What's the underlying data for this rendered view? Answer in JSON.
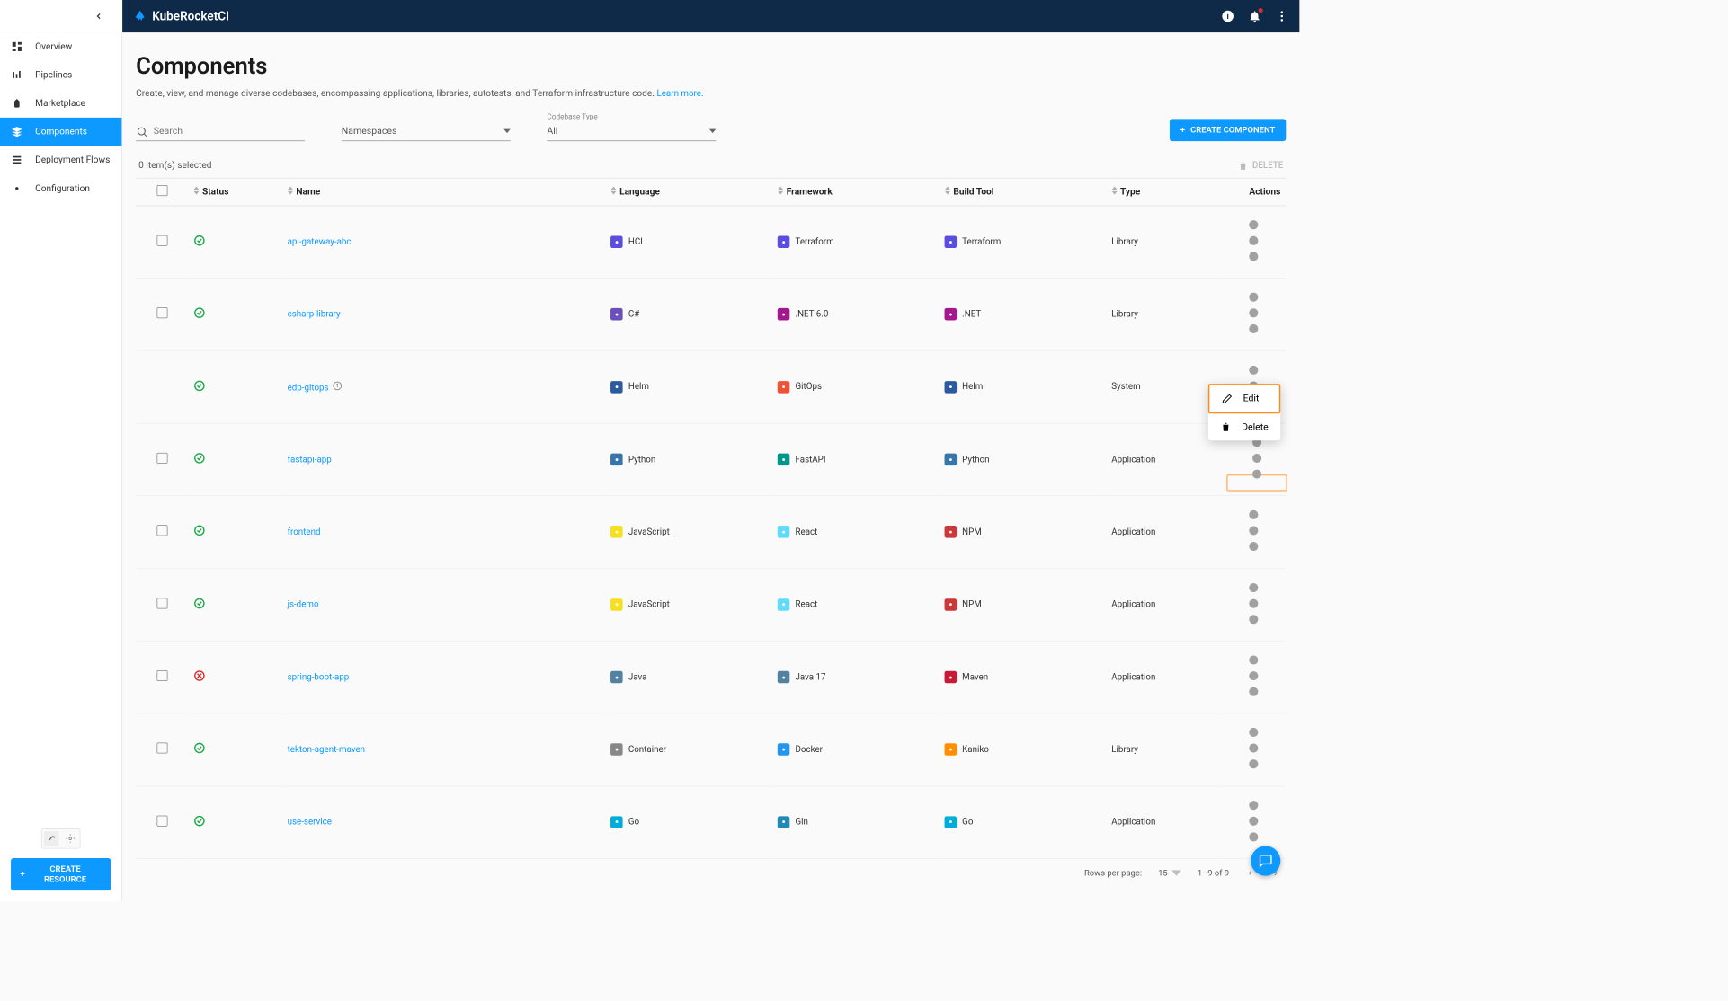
{
  "app": {
    "name": "KubeRocketCI"
  },
  "sidebar": {
    "items": [
      {
        "label": "Overview"
      },
      {
        "label": "Pipelines"
      },
      {
        "label": "Marketplace"
      },
      {
        "label": "Components"
      },
      {
        "label": "Deployment Flows"
      },
      {
        "label": "Configuration"
      }
    ],
    "create_resource": "CREATE RESOURCE"
  },
  "page": {
    "title": "Components",
    "subtitle": "Create, view, and manage diverse codebases, encompassing applications, libraries, autotests, and Terraform infrastructure code.",
    "learn_more": "Learn more."
  },
  "filters": {
    "search_placeholder": "Search",
    "namespaces_label": "Namespaces",
    "codebase_type_label": "Codebase Type",
    "codebase_type_value": "All",
    "create_component": "CREATE COMPONENT"
  },
  "selection": {
    "text": "0 item(s) selected",
    "delete": "DELETE"
  },
  "columns": {
    "status": "Status",
    "name": "Name",
    "language": "Language",
    "framework": "Framework",
    "buildtool": "Build Tool",
    "type": "Type",
    "actions": "Actions"
  },
  "rows": [
    {
      "name": "api-gateway-abc",
      "lang": "HCL",
      "framework": "Terraform",
      "buildtool": "Terraform",
      "type": "Library",
      "status": "ok",
      "selectable": true,
      "lang_bg": "#5b4de0",
      "fw_bg": "#5b4de0",
      "bt_bg": "#5b4de0"
    },
    {
      "name": "csharp-library",
      "lang": "C#",
      "framework": ".NET 6.0",
      "buildtool": ".NET",
      "type": "Library",
      "status": "ok",
      "selectable": true,
      "lang_bg": "#6b4fbb",
      "fw_bg": "#a4178e",
      "bt_bg": "#a4178e"
    },
    {
      "name": "edp-gitops",
      "lang": "Helm",
      "framework": "GitOps",
      "buildtool": "Helm",
      "type": "System",
      "status": "ok",
      "selectable": false,
      "info": true,
      "lang_bg": "#2c5aa0",
      "fw_bg": "#f05033",
      "bt_bg": "#2c5aa0"
    },
    {
      "name": "fastapi-app",
      "lang": "Python",
      "framework": "FastAPI",
      "buildtool": "Python",
      "type": "Application",
      "status": "ok",
      "selectable": true,
      "highlight": true,
      "lang_bg": "#3776ab",
      "fw_bg": "#009688",
      "bt_bg": "#3776ab"
    },
    {
      "name": "frontend",
      "lang": "JavaScript",
      "framework": "React",
      "buildtool": "NPM",
      "type": "Application",
      "status": "ok",
      "selectable": true,
      "lang_bg": "#f7df1e",
      "fw_bg": "#61dafb",
      "bt_bg": "#cb3837"
    },
    {
      "name": "js-demo",
      "lang": "JavaScript",
      "framework": "React",
      "buildtool": "NPM",
      "type": "Application",
      "status": "ok",
      "selectable": true,
      "lang_bg": "#f7df1e",
      "fw_bg": "#61dafb",
      "bt_bg": "#cb3837"
    },
    {
      "name": "spring-boot-app",
      "lang": "Java",
      "framework": "Java 17",
      "buildtool": "Maven",
      "type": "Application",
      "status": "fail",
      "selectable": true,
      "lang_bg": "#5382a1",
      "fw_bg": "#5382a1",
      "bt_bg": "#c71a36"
    },
    {
      "name": "tekton-agent-maven",
      "lang": "Container",
      "framework": "Docker",
      "buildtool": "Kaniko",
      "type": "Library",
      "status": "ok",
      "selectable": true,
      "lang_bg": "#888",
      "fw_bg": "#2496ed",
      "bt_bg": "#ff8f00"
    },
    {
      "name": "use-service",
      "lang": "Go",
      "framework": "Gin",
      "buildtool": "Go",
      "type": "Application",
      "status": "ok",
      "selectable": true,
      "lang_bg": "#00add8",
      "fw_bg": "#2089b5",
      "bt_bg": "#00add8"
    }
  ],
  "popup": {
    "edit": "Edit",
    "delete": "Delete"
  },
  "pagination": {
    "rows_per_page": "Rows per page:",
    "rows_value": "15",
    "range": "1–9 of 9"
  }
}
